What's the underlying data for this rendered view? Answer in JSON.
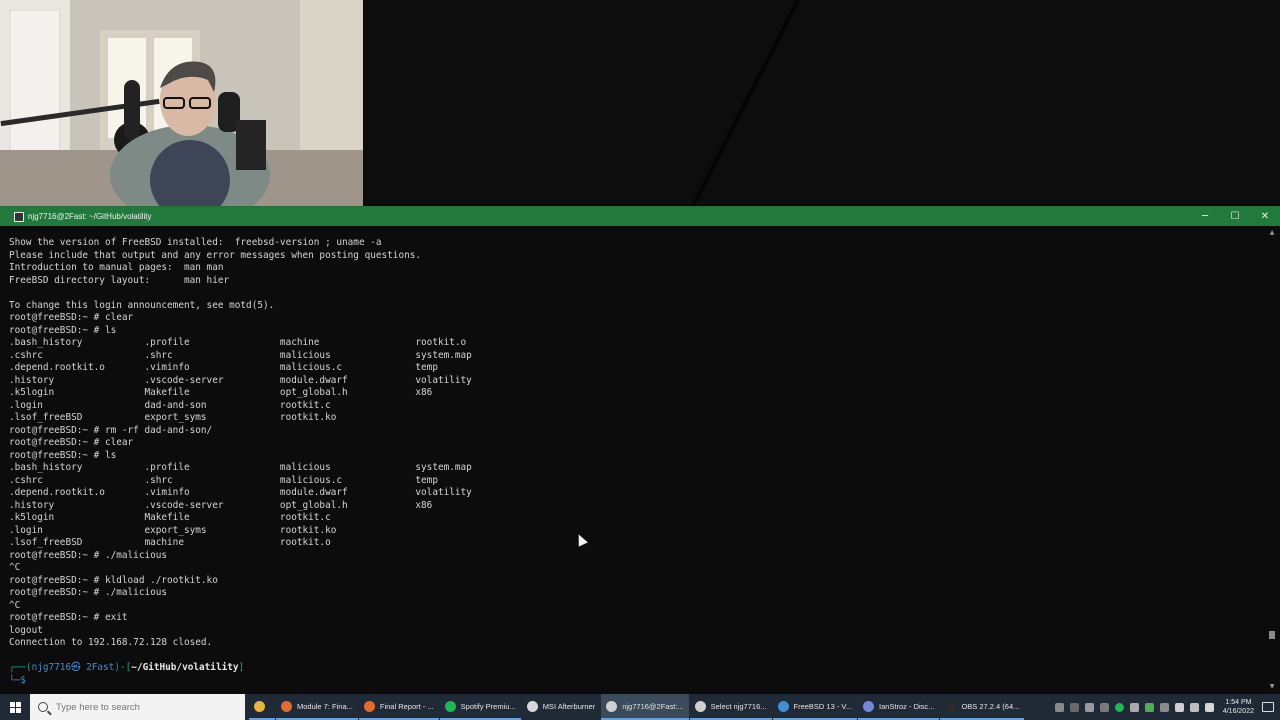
{
  "window": {
    "title": "njg7716@2Fast: ~/GitHub/volatility",
    "controls": {
      "minimize": "─",
      "maximize": "☐",
      "close": "✕"
    }
  },
  "terminal": {
    "lines": [
      "Show the version of FreeBSD installed:  freebsd-version ; uname -a",
      "Please include that output and any error messages when posting questions.",
      "Introduction to manual pages:  man man",
      "FreeBSD directory layout:      man hier",
      "",
      "To change this login announcement, see motd(5).",
      "root@freeBSD:~ # clear",
      "root@freeBSD:~ # ls",
      ".bash_history           .profile                machine                 rootkit.o",
      ".cshrc                  .shrc                   malicious               system.map",
      ".depend.rootkit.o       .viminfo                malicious.c             temp",
      ".history                .vscode-server          module.dwarf            volatility",
      ".k5login                Makefile                opt_global.h            x86",
      ".login                  dad-and-son             rootkit.c",
      ".lsof_freeBSD           export_syms             rootkit.ko",
      "root@freeBSD:~ # rm -rf dad-and-son/",
      "root@freeBSD:~ # clear",
      "root@freeBSD:~ # ls",
      ".bash_history           .profile                malicious               system.map",
      ".cshrc                  .shrc                   malicious.c             temp",
      ".depend.rootkit.o       .viminfo                module.dwarf            volatility",
      ".history                .vscode-server          opt_global.h            x86",
      ".k5login                Makefile                rootkit.c",
      ".login                  export_syms             rootkit.ko",
      ".lsof_freeBSD           machine                 rootkit.o",
      "root@freeBSD:~ # ./malicious",
      "^C",
      "root@freeBSD:~ # kldload ./rootkit.ko",
      "root@freeBSD:~ # ./malicious",
      "^C",
      "root@freeBSD:~ # exit",
      "logout",
      "Connection to 192.168.72.128 closed.",
      ""
    ],
    "prompt": {
      "line1_prefix": "┌──(",
      "user_host": "njg7716㉿ 2Fast",
      "line1_mid": ")-[",
      "path": "~/GitHub/volatility",
      "line1_suffix": "]",
      "line2": "└─$"
    }
  },
  "taskbar": {
    "search_placeholder": "Type here to search",
    "items": [
      {
        "label": "",
        "icon": "file-explorer-icon",
        "color": "#e8b53c"
      },
      {
        "label": "Module 7: Fina...",
        "icon": "firefox-icon",
        "color": "#e66a2c"
      },
      {
        "label": "Final Report - ...",
        "icon": "firefox-icon",
        "color": "#e66a2c"
      },
      {
        "label": "Spotify Premiu...",
        "icon": "spotify-icon",
        "color": "#1db954"
      },
      {
        "label": "MSI Afterburner",
        "icon": "msi-afterburner-icon",
        "color": "#d8d8d8"
      },
      {
        "label": "njg7716@2Fast:...",
        "icon": "terminal-icon",
        "color": "#cfcfcf"
      },
      {
        "label": "Select njg7716...",
        "icon": "terminal-icon",
        "color": "#cfcfcf"
      },
      {
        "label": "FreeBSD 13 - V...",
        "icon": "vmware-icon",
        "color": "#3f8fd2"
      },
      {
        "label": "IanStroz - Disc...",
        "icon": "discord-icon",
        "color": "#7289da"
      },
      {
        "label": "OBS 27.2.4 (64...",
        "icon": "obs-icon",
        "color": "#2b2b2b"
      }
    ],
    "clock_time": "1:54 PM",
    "clock_date": "4/16/2022"
  }
}
